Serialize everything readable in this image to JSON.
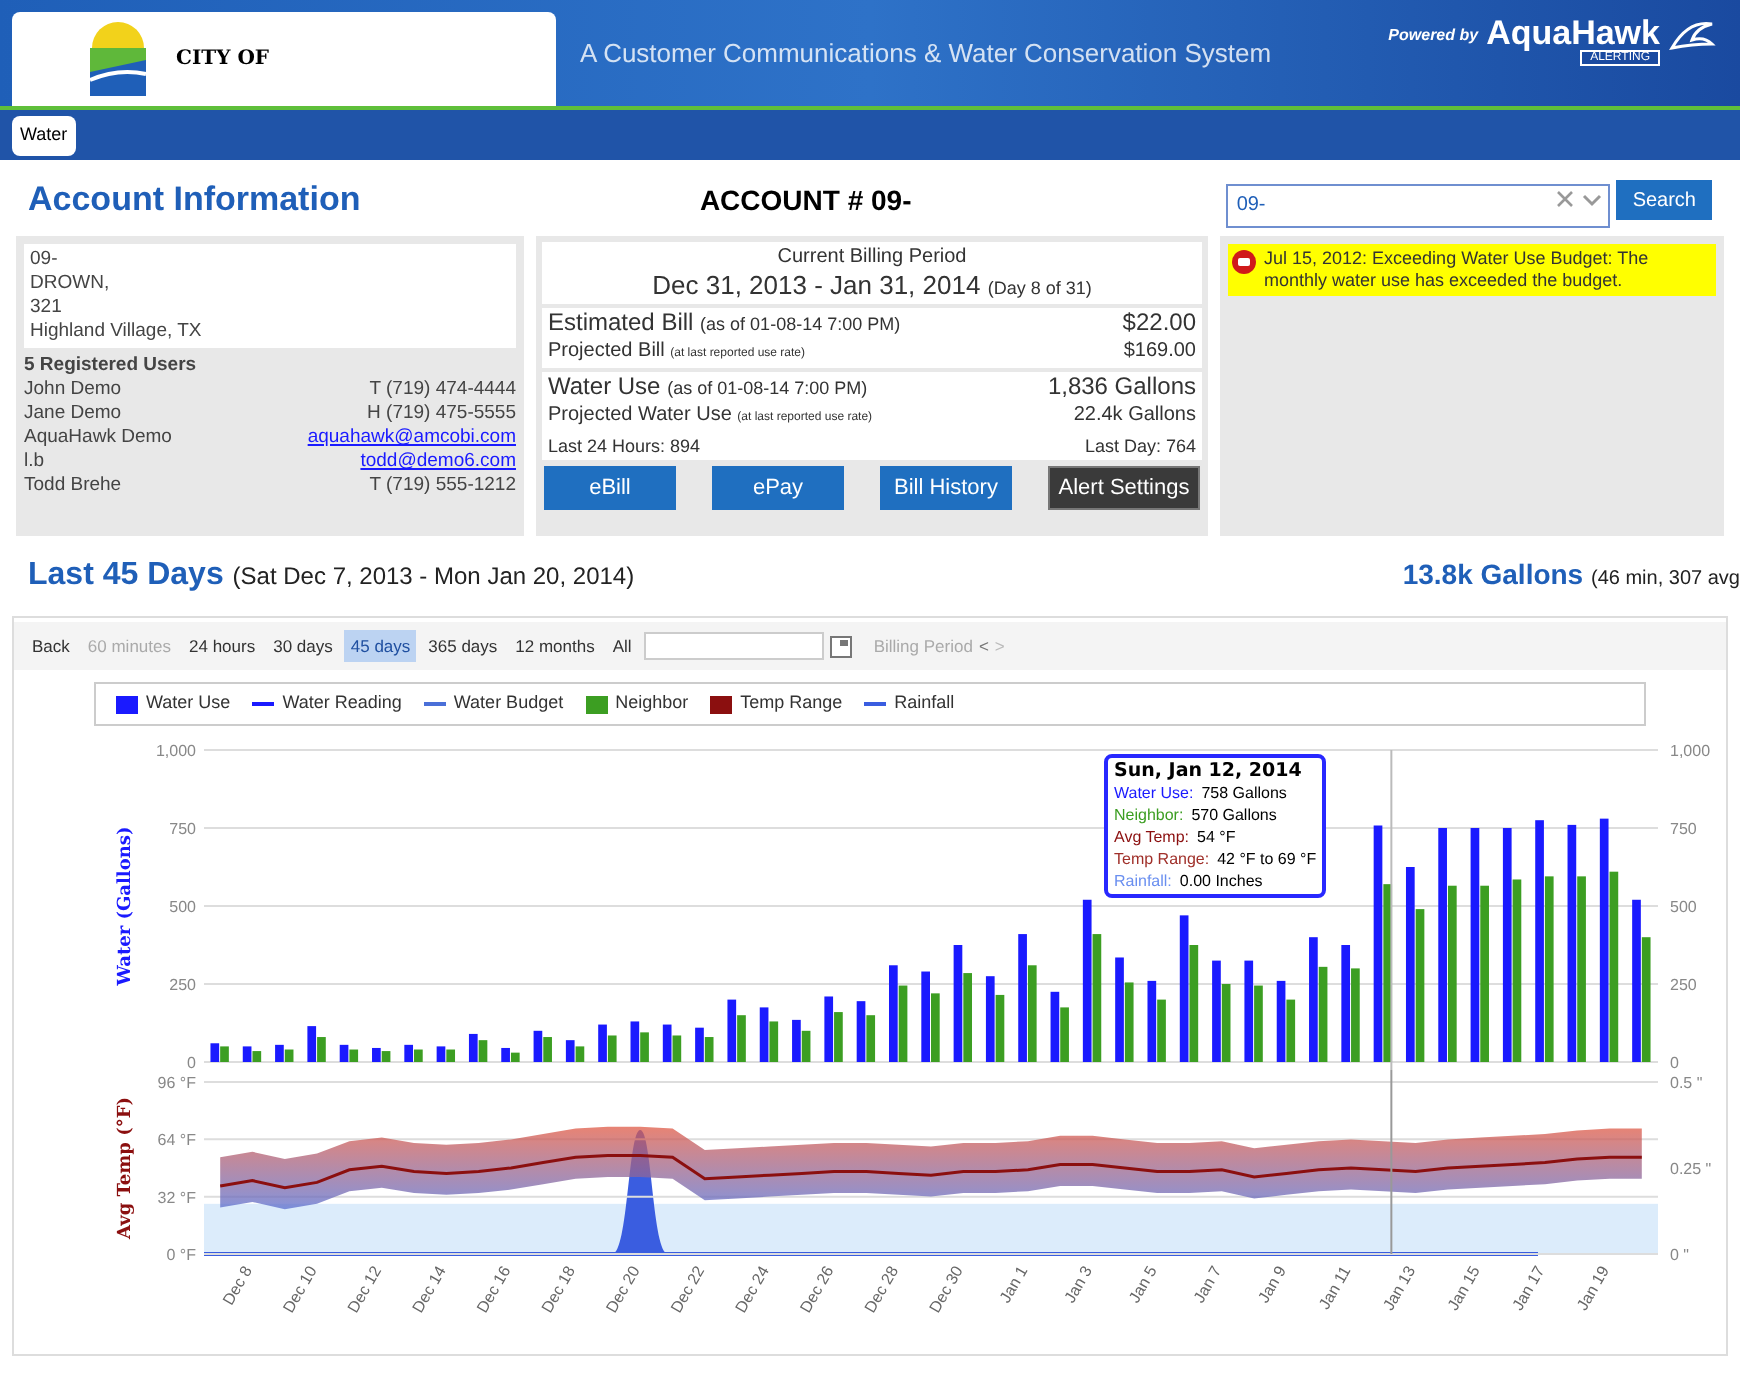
{
  "header": {
    "city": "CITY OF",
    "tagline": "A Customer Communications & Water Conservation System",
    "powered_by": "Powered by",
    "brand": "AquaHawk",
    "brand_sub": "ALERTING"
  },
  "nav": {
    "tabs": [
      {
        "label": "Water",
        "selected": true
      }
    ]
  },
  "account": {
    "title": "Account Information",
    "number": "ACCOUNT # 09-",
    "search": {
      "value": "09-",
      "button": "Search"
    }
  },
  "customer": {
    "lines": [
      "09-",
      "DROWN,",
      "321",
      "Highland Village, TX"
    ],
    "users_title": "5 Registered Users",
    "users": [
      {
        "name": "John Demo",
        "contact": "T (719) 474-4444",
        "kind": "phone"
      },
      {
        "name": "Jane Demo",
        "contact": "H (719) 475-5555",
        "kind": "phone"
      },
      {
        "name": "AquaHawk Demo",
        "contact": "aquahawk@amcobi.com",
        "kind": "email"
      },
      {
        "name": "l.b",
        "contact": "todd@demo6.com",
        "kind": "email"
      },
      {
        "name": "Todd Brehe",
        "contact": "T (719) 555-1212",
        "kind": "phone"
      }
    ]
  },
  "billing": {
    "title": "Current Billing Period",
    "period": "Dec 31, 2013 - Jan 31, 2014",
    "day": "(Day 8 of 31)",
    "estimated": {
      "label": "Estimated Bill",
      "asof": "(as of 01-08-14 7:00 PM)",
      "value": "$22.00"
    },
    "projected": {
      "label": "Projected Bill",
      "note": "(at last reported use rate)",
      "value": "$169.00"
    },
    "water_use": {
      "label": "Water Use",
      "asof": "(as of 01-08-14 7:00 PM)",
      "value": "1,836 Gallons"
    },
    "projected_use": {
      "label": "Projected Water Use",
      "note": "(at last reported use rate)",
      "value": "22.4k Gallons"
    },
    "last24": "Last 24 Hours: 894",
    "lastday": "Last Day: 764",
    "buttons": [
      {
        "label": "eBill",
        "kind": "primary"
      },
      {
        "label": "ePay",
        "kind": "primary"
      },
      {
        "label": "Bill History",
        "kind": "primary"
      },
      {
        "label": "Alert Settings",
        "kind": "dark"
      }
    ]
  },
  "alert": {
    "text": "Jul 15, 2012: Exceeding Water Use Budget: The monthly water use has exceeded the budget."
  },
  "summary": {
    "title": "Last 45 Days",
    "range": "(Sat Dec 7, 2013 - Mon Jan 20, 2014)",
    "total": "13.8k Gallons",
    "detail": "(46 min, 307 avg"
  },
  "toolbar": {
    "items": [
      {
        "label": "Back",
        "selected": false,
        "disabled": false
      },
      {
        "label": "60 minutes",
        "selected": false,
        "disabled": true
      },
      {
        "label": "24 hours",
        "selected": false,
        "disabled": false
      },
      {
        "label": "30 days",
        "selected": false,
        "disabled": false
      },
      {
        "label": "45 days",
        "selected": true,
        "disabled": false
      },
      {
        "label": "365 days",
        "selected": false,
        "disabled": false
      },
      {
        "label": "12 months",
        "selected": false,
        "disabled": false
      },
      {
        "label": "All",
        "selected": false,
        "disabled": false
      }
    ],
    "billing_period": "Billing Period",
    "prev": "<",
    "next": ">"
  },
  "legend": [
    {
      "label": "Water Use",
      "kind": "box",
      "color": "#1a1aff"
    },
    {
      "label": "Water Reading",
      "kind": "line",
      "color": "#1a1aff"
    },
    {
      "label": "Water Budget",
      "kind": "line",
      "color": "#4a6fd8"
    },
    {
      "label": "Neighbor",
      "kind": "box",
      "color": "#3c9e22"
    },
    {
      "label": "Temp Range",
      "kind": "box",
      "color": "#8b0f0f"
    },
    {
      "label": "Rainfall",
      "kind": "line",
      "color": "#3a5de0"
    }
  ],
  "tooltip": {
    "title": "Sun, Jan 12, 2014",
    "rows": [
      {
        "label": "Water Use:",
        "value": "758 Gallons",
        "color": "#1a1aff"
      },
      {
        "label": "Neighbor:",
        "value": "570 Gallons",
        "color": "#3c9e22"
      },
      {
        "label": "Avg Temp:",
        "value": "54 °F",
        "color": "#8b0f0f"
      },
      {
        "label": "Temp Range:",
        "value": "42 °F to 69 °F",
        "color": "#a0302a"
      },
      {
        "label": "Rainfall:",
        "value": "0.00 Inches",
        "color": "#6a8ff0"
      }
    ]
  },
  "water_chart": {
    "chart_data": {
      "type": "bar",
      "ylabel": "Water (Gallons)",
      "grid": true,
      "ylim": [
        0,
        1000
      ],
      "yticks": [
        {
          "value": 0,
          "label": "0"
        },
        {
          "value": 250,
          "label": "250"
        },
        {
          "value": 500,
          "label": "500"
        },
        {
          "value": 750,
          "label": "750"
        },
        {
          "value": 1000,
          "label": "1,000"
        }
      ],
      "series": [
        {
          "color": "#1a1aff",
          "values": [
            60,
            50,
            55,
            115,
            55,
            45,
            55,
            50,
            90,
            45,
            100,
            70,
            120,
            130,
            120,
            110,
            200,
            175,
            135,
            210,
            195,
            310,
            290,
            375,
            275,
            410,
            225,
            520,
            335,
            260,
            470,
            325,
            325,
            260,
            400,
            375,
            758,
            625,
            750,
            750,
            750,
            775,
            760,
            780,
            520
          ]
        },
        {
          "color": "#3c9e22",
          "values": [
            50,
            35,
            40,
            80,
            40,
            35,
            40,
            40,
            70,
            30,
            80,
            50,
            85,
            95,
            85,
            80,
            150,
            130,
            100,
            160,
            150,
            245,
            220,
            285,
            215,
            310,
            175,
            410,
            255,
            200,
            375,
            250,
            245,
            200,
            305,
            300,
            570,
            490,
            565,
            565,
            585,
            595,
            595,
            610,
            400
          ]
        }
      ]
    }
  },
  "temp_chart": {
    "rainfall_ticks": [
      "0.5 \"",
      "0.25 \"",
      "0 \""
    ],
    "chart_data": {
      "type": "line",
      "ylabel": "Avg Temp (°F)",
      "grid": true,
      "ylim": [
        0,
        96
      ],
      "yticks": [
        {
          "value": 0,
          "label": "0 °F"
        },
        {
          "value": 32,
          "label": "32 °F"
        },
        {
          "value": 64,
          "label": "64 °F"
        },
        {
          "value": 96,
          "label": "96 °F"
        }
      ],
      "categories": [
        null,
        "Dec 8",
        null,
        "Dec 10",
        null,
        "Dec 12",
        null,
        "Dec 14",
        null,
        "Dec 16",
        null,
        "Dec 18",
        null,
        "Dec 20",
        null,
        "Dec 22",
        null,
        "Dec 24",
        null,
        "Dec 26",
        null,
        "Dec 28",
        null,
        "Dec 30",
        null,
        "Jan 1",
        null,
        "Jan 3",
        null,
        "Jan 5",
        null,
        "Jan 7",
        null,
        "Jan 9",
        null,
        "Jan 11",
        null,
        "Jan 13",
        null,
        "Jan 15",
        null,
        "Jan 17",
        null,
        "Jan 19",
        null
      ],
      "series": [
        {
          "type": "line",
          "color": "#8b0f0f",
          "values": [
            38,
            41,
            37,
            40,
            47,
            49,
            46,
            45,
            46,
            48,
            51,
            54,
            55,
            55,
            54,
            42,
            43,
            44,
            45,
            46,
            46,
            45,
            44,
            46,
            46,
            47,
            50,
            50,
            48,
            46,
            46,
            47,
            43,
            45,
            47,
            48,
            47,
            46,
            48,
            49,
            50,
            51,
            53,
            54,
            54
          ]
        }
      ]
    }
  }
}
